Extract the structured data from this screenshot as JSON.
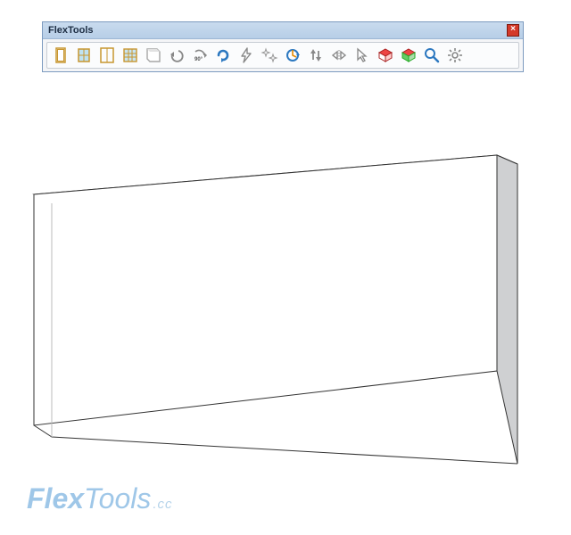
{
  "window": {
    "title": "FlexTools",
    "close_label": "×"
  },
  "toolbar": {
    "icons": [
      "flexdoor-icon",
      "flexwindow-icon",
      "flexdoor-double-icon",
      "flexwindow-grid-icon",
      "flexwall-icon",
      "undo-icon",
      "rotate-90-icon",
      "refresh-icon",
      "lightning-icon",
      "sparkle-icon",
      "dynamic-refresh-icon",
      "arrows-updown-icon",
      "mirror-icon",
      "select-arrow-icon",
      "component-red-icon",
      "component-green-icon",
      "zoom-icon",
      "settings-icon"
    ]
  },
  "watermark": {
    "brand_bold": "Flex",
    "brand_light": "Tools",
    "suffix": ".cc"
  }
}
